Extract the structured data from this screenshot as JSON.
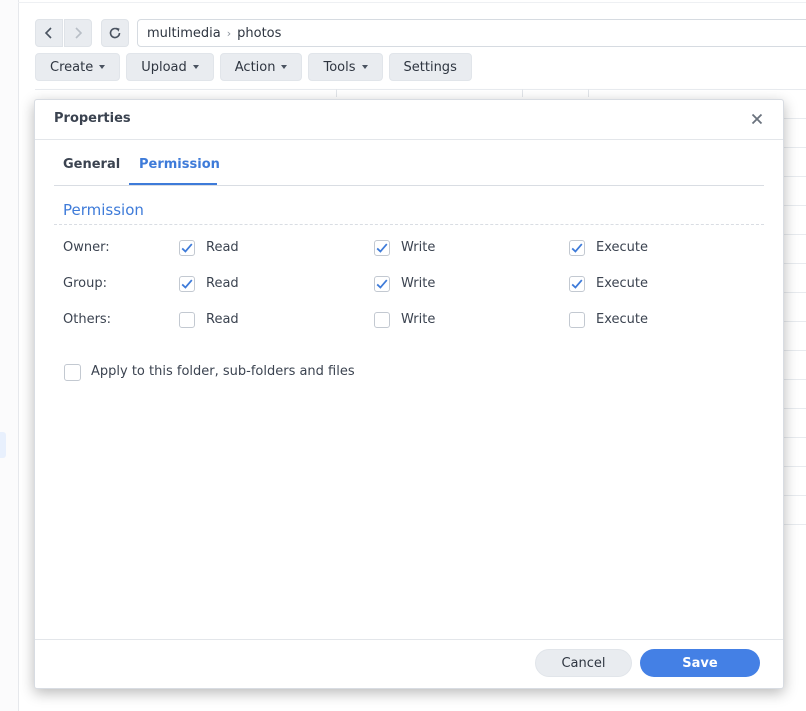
{
  "path": {
    "segments": [
      "multimedia",
      "photos"
    ],
    "separator": "›"
  },
  "toolbar": {
    "buttons": [
      {
        "label": "Create",
        "dropdown": true
      },
      {
        "label": "Upload",
        "dropdown": true
      },
      {
        "label": "Action",
        "dropdown": true
      },
      {
        "label": "Tools",
        "dropdown": true
      },
      {
        "label": "Settings",
        "dropdown": false
      }
    ]
  },
  "dialog": {
    "title": "Properties",
    "tabs": [
      {
        "label": "General",
        "active": false
      },
      {
        "label": "Permission",
        "active": true
      }
    ],
    "section_title": "Permission",
    "rows": [
      {
        "label": "Owner:",
        "perms": [
          {
            "label": "Read",
            "checked": true
          },
          {
            "label": "Write",
            "checked": true
          },
          {
            "label": "Execute",
            "checked": true
          }
        ]
      },
      {
        "label": "Group:",
        "perms": [
          {
            "label": "Read",
            "checked": true
          },
          {
            "label": "Write",
            "checked": true
          },
          {
            "label": "Execute",
            "checked": true
          }
        ]
      },
      {
        "label": "Others:",
        "perms": [
          {
            "label": "Read",
            "checked": false
          },
          {
            "label": "Write",
            "checked": false
          },
          {
            "label": "Execute",
            "checked": false
          }
        ]
      }
    ],
    "apply_recursive": {
      "label": "Apply to this folder, sub-folders and files",
      "checked": false
    },
    "cancel_label": "Cancel",
    "save_label": "Save"
  },
  "colors": {
    "accent": "#3e7bd9",
    "primary_button": "#4480e5",
    "button_bg": "#e9ecf0"
  },
  "icons": {
    "back": "chevron-left-icon",
    "forward": "chevron-right-icon",
    "refresh": "refresh-icon",
    "close": "close-icon",
    "check": "check-icon"
  }
}
